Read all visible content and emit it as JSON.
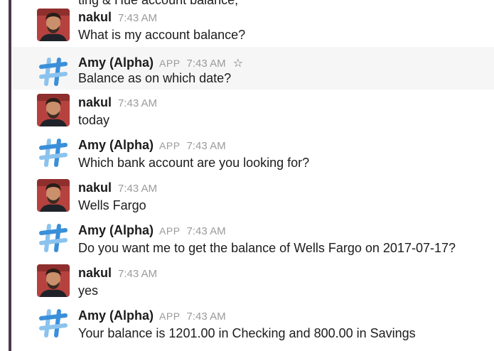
{
  "top_clipped_text": "ting & Hue account balance,",
  "messages": [
    {
      "sender": "nakul",
      "type": "user",
      "time": "7:43 AM",
      "text": "What is my account balance?"
    },
    {
      "sender": "Amy (Alpha)",
      "type": "bot",
      "badge": "APP",
      "time": "7:43 AM",
      "text": "Balance as on which date?",
      "highlight": true,
      "star": "☆"
    },
    {
      "sender": "nakul",
      "type": "user",
      "time": "7:43 AM",
      "text": "today"
    },
    {
      "sender": "Amy (Alpha)",
      "type": "bot",
      "badge": "APP",
      "time": "7:43 AM",
      "text": "Which bank account are you looking for?"
    },
    {
      "sender": "nakul",
      "type": "user",
      "time": "7:43 AM",
      "text": "Wells Fargo"
    },
    {
      "sender": "Amy (Alpha)",
      "type": "bot",
      "badge": "APP",
      "time": "7:43 AM",
      "text": "Do you want me to get the balance of Wells Fargo on 2017-07-17?"
    },
    {
      "sender": "nakul",
      "type": "user",
      "time": "7:43 AM",
      "text": "yes"
    },
    {
      "sender": "Amy (Alpha)",
      "type": "bot",
      "badge": "APP",
      "time": "7:43 AM",
      "text": "Your balance is 1201.00 in Checking and 800.00 in Savings"
    }
  ],
  "colors": {
    "sidebar_rail": "#4d394b",
    "highlight_row": "#f6f6f6",
    "meta_gray": "#9a9a9a",
    "bot_icon_blue": "#3a8fd9",
    "bot_icon_light": "#8cc3ee"
  },
  "icons": {
    "user_avatar": "user-avatar-photo",
    "bot_avatar": "hash-bot-icon",
    "star": "star-outline-icon"
  }
}
